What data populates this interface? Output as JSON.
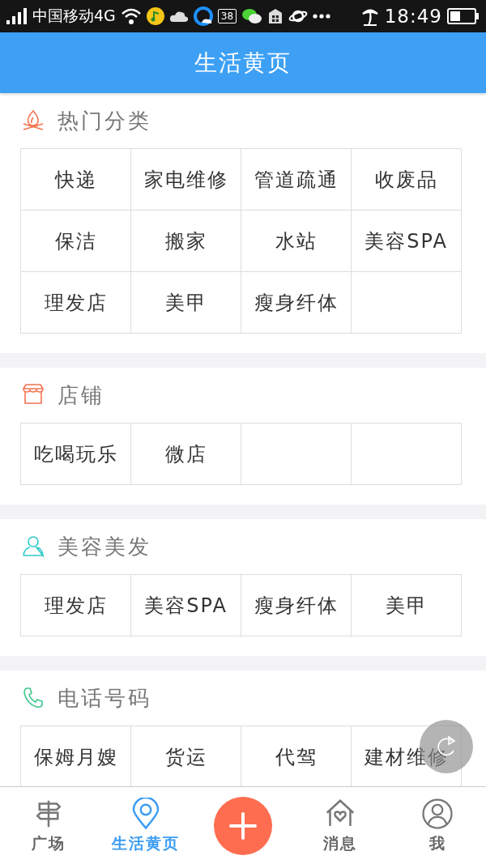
{
  "status_bar": {
    "carrier": "中国移动4G",
    "notification_count": "38",
    "time": "18:49"
  },
  "header": {
    "title": "生活黄页"
  },
  "sections": [
    {
      "title": "热门分类",
      "cells": [
        "快递",
        "家电维修",
        "管道疏通",
        "收废品",
        "保洁",
        "搬家",
        "水站",
        "美容SPA",
        "理发店",
        "美甲",
        "瘦身纤体",
        null
      ]
    },
    {
      "title": "店铺",
      "cells": [
        "吃喝玩乐",
        "微店",
        null,
        null
      ]
    },
    {
      "title": "美容美发",
      "cells": [
        "理发店",
        "美容SPA",
        "瘦身纤体",
        "美甲"
      ]
    },
    {
      "title": "电话号码",
      "cells": [
        "保姆月嫂",
        "货运",
        "代驾",
        "建材维修"
      ]
    }
  ],
  "bottom_nav": [
    {
      "kind": "tab",
      "label": "广场",
      "selected": false
    },
    {
      "kind": "tab",
      "label": "生活黄页",
      "selected": true
    },
    {
      "kind": "add"
    },
    {
      "kind": "tab",
      "label": "消息",
      "selected": false
    },
    {
      "kind": "tab",
      "label": "我",
      "selected": false
    }
  ]
}
